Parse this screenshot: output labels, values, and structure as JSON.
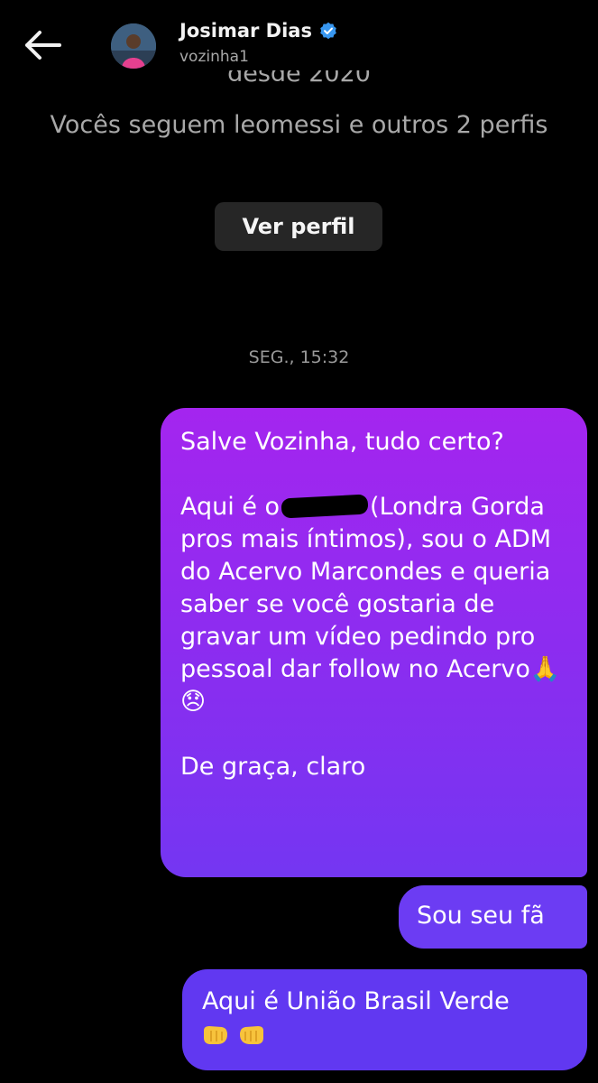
{
  "header": {
    "back_icon": "arrow-left-icon",
    "name": "Josimar Dias",
    "verified_icon": "verified-badge-icon",
    "username": "vozinha1"
  },
  "profile_card": {
    "since_text": "desde 2020",
    "follow_info": "Vocês seguem leomessi e outros 2 perfis",
    "view_profile_label": "Ver perfil"
  },
  "timestamp": "SEG., 15:32",
  "messages": [
    {
      "paragraphs": [
        "Salve Vozinha, tudo certo?",
        "Aqui é o",
        "(Londra Gorda pros mais íntimos), sou o ADM do Acervo Marcondes e queria saber se você gostaria de gravar um vídeo pedindo pro pessoal dar follow no Acervo",
        "De graça, claro"
      ],
      "emojis": "🙏😞"
    },
    {
      "text": "Sou seu fã"
    },
    {
      "text": "Aqui é União Brasil Verde",
      "emoji_icons": "fist-bump-icon"
    }
  ],
  "colors": {
    "background": "#000000",
    "bubble_top": "#a425ef",
    "bubble_bottom": "#6138f1",
    "button_bg": "#262626",
    "verified": "#3897f0"
  }
}
